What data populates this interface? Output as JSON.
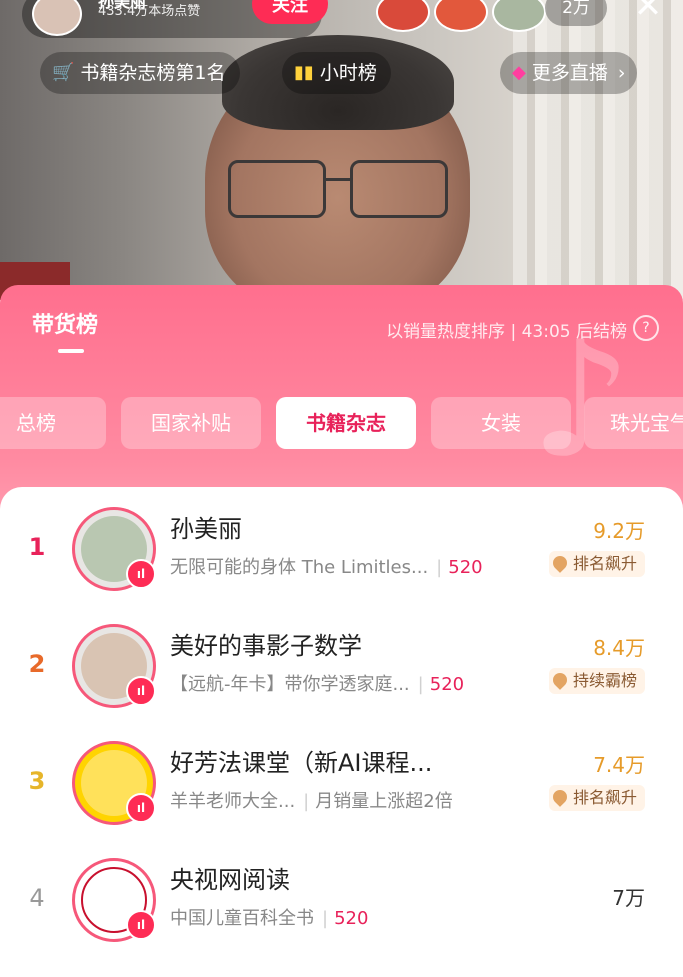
{
  "header": {
    "anchor_name": "孙美丽",
    "anchor_likes": "433.4万本场点赞",
    "follow_label": "关注",
    "viewer_count": "2万",
    "close_icon": "close-icon"
  },
  "pills": [
    {
      "icon": "cart-icon",
      "label": "书籍杂志榜第1名"
    },
    {
      "icon": "bar-chart-icon",
      "label": "小时榜"
    },
    {
      "icon": "live-icon",
      "label": "更多直播"
    }
  ],
  "panel": {
    "title": "带货榜",
    "sort_info": "以销量热度排序 | 43:05 后结榜",
    "help_icon": "help-icon"
  },
  "tabs": [
    "总榜",
    "国家补贴",
    "书籍杂志",
    "女装",
    "珠光宝气"
  ],
  "active_tab": "书籍杂志",
  "rows": [
    {
      "rank": "1",
      "name": "孙美丽",
      "desc": "无限可能的身体 The Limitles...",
      "tag": "520",
      "sales": "9.2万",
      "trend": "排名飙升"
    },
    {
      "rank": "2",
      "name": "美好的事影子数学",
      "desc": "【远航-年卡】带你学透家庭...",
      "tag": "520",
      "sales": "8.4万",
      "trend": "持续霸榜"
    },
    {
      "rank": "3",
      "name": "好芳法课堂（新AI课程...",
      "desc": "羊羊老师大全...",
      "tag": "月销量上涨超2倍",
      "sales": "7.4万",
      "trend": "排名飙升"
    },
    {
      "rank": "4",
      "name": "央视网阅读",
      "desc": "中国儿童百科全书",
      "tag": "520",
      "sales": "7万",
      "trend": ""
    }
  ],
  "colors": {
    "accent": "#fe2c55",
    "rank1": "#e8225a",
    "rank2": "#e86a2a",
    "rank3": "#e6b52a",
    "rank4": "#999999"
  }
}
